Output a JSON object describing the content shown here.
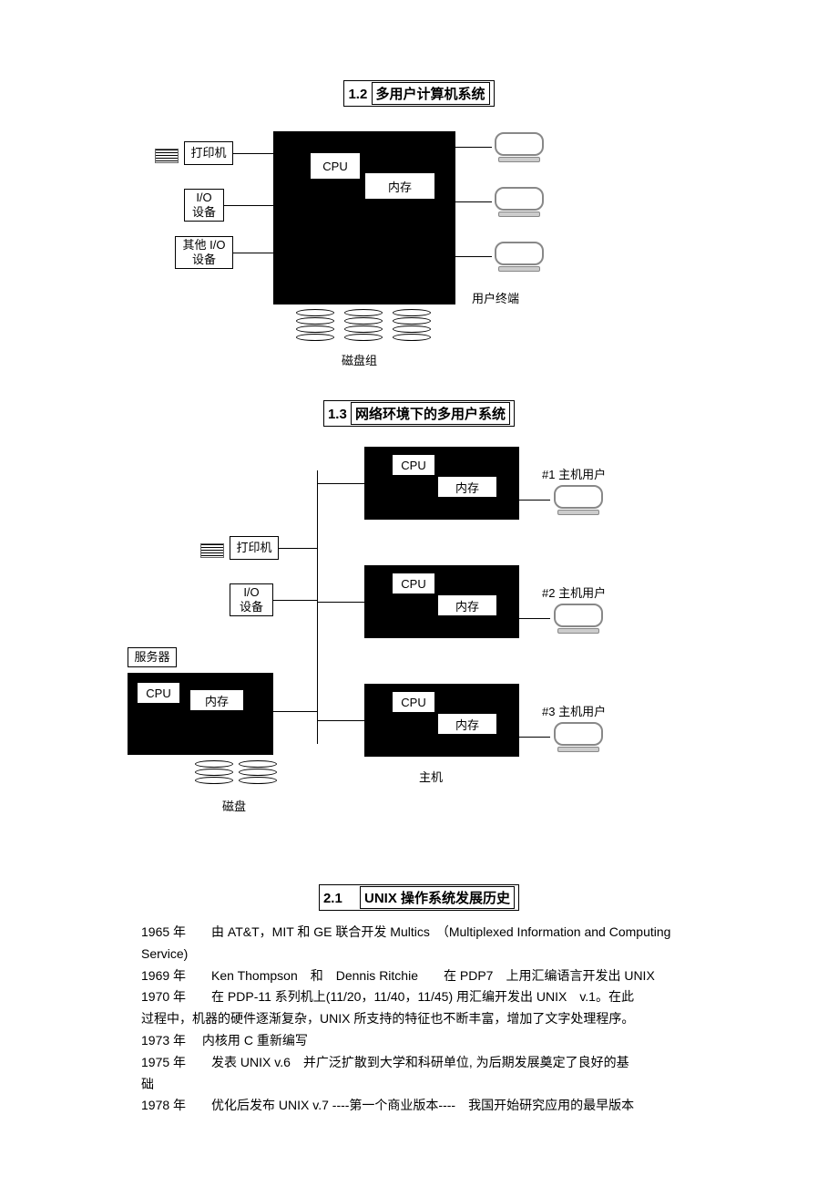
{
  "sections": {
    "s12": {
      "num": "1.2",
      "title": "多用户计算机系统"
    },
    "s13": {
      "num": "1.3",
      "title": "网络环境下的多用户系统"
    },
    "s21": {
      "num": "2.1",
      "title": "UNIX 操作系统发展历史"
    }
  },
  "diagram12": {
    "printer": "打印机",
    "io": "I/O\n设备",
    "otherio": "其他 I/O\n设备",
    "cpu": "CPU",
    "memory": "内存",
    "diskgroup": "磁盘组",
    "userterm": "用户终端"
  },
  "diagram13": {
    "printer": "打印机",
    "io": "I/O\n设备",
    "server": "服务器",
    "cpu": "CPU",
    "memory": "内存",
    "disk": "磁盘",
    "hosts": "主机",
    "host1": "#1 主机用户",
    "host2": "#2 主机用户",
    "host3": "#3 主机用户"
  },
  "history": {
    "lines": [
      "1965 年　　由 AT&T，MIT 和 GE 联合开发 Multics　（Multiplexed Information and Computing",
      "Service)",
      "1969 年　　Ken Thompson　和　Dennis Ritchie　　在 PDP7　上用汇编语言开发出 UNIX",
      "1970 年　　在 PDP-11 系列机上(11/20，11/40，11/45) 用汇编开发出 UNIX　v.1。在此",
      "过程中，机器的硬件逐渐复杂，UNIX 所支持的特征也不断丰富，增加了文字处理程序。",
      "1973 年　 内核用 C 重新编写",
      "1975 年　　发表 UNIX v.6　并广泛扩散到大学和科研单位, 为后期发展奠定了良好的基"
    ],
    "out": "础",
    "last": "1978 年　　优化后发布 UNIX v.7 ----第一个商业版本----　我国开始研究应用的最早版本"
  }
}
